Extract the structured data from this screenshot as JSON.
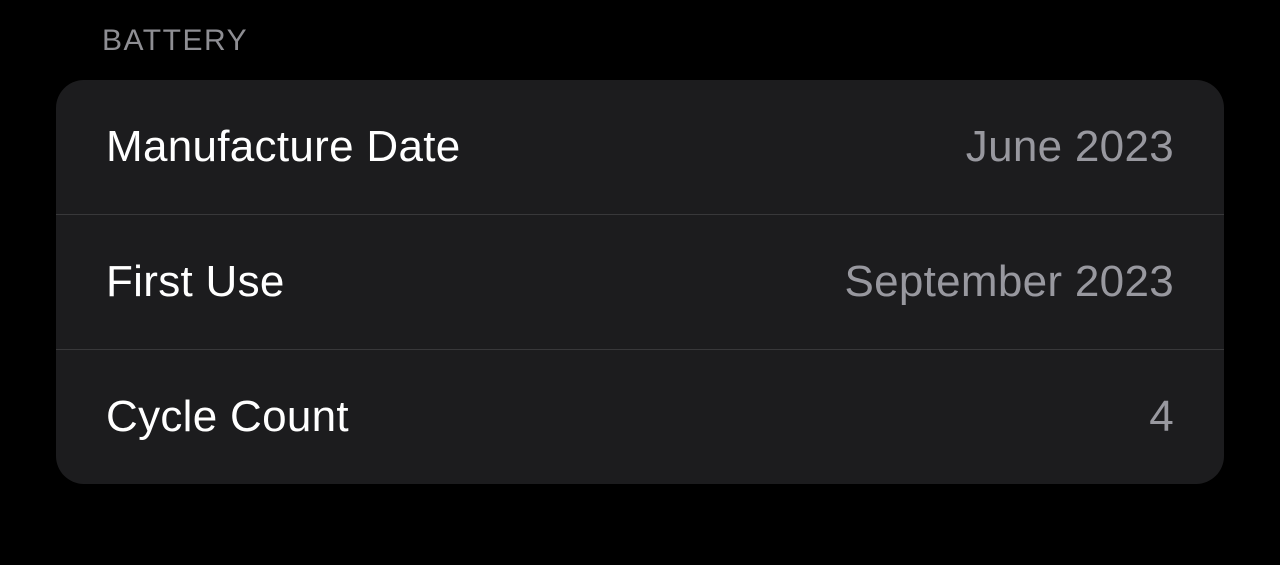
{
  "section": {
    "header": "BATTERY",
    "rows": [
      {
        "label": "Manufacture Date",
        "value": "June 2023"
      },
      {
        "label": "First Use",
        "value": "September 2023"
      },
      {
        "label": "Cycle Count",
        "value": "4"
      }
    ]
  }
}
